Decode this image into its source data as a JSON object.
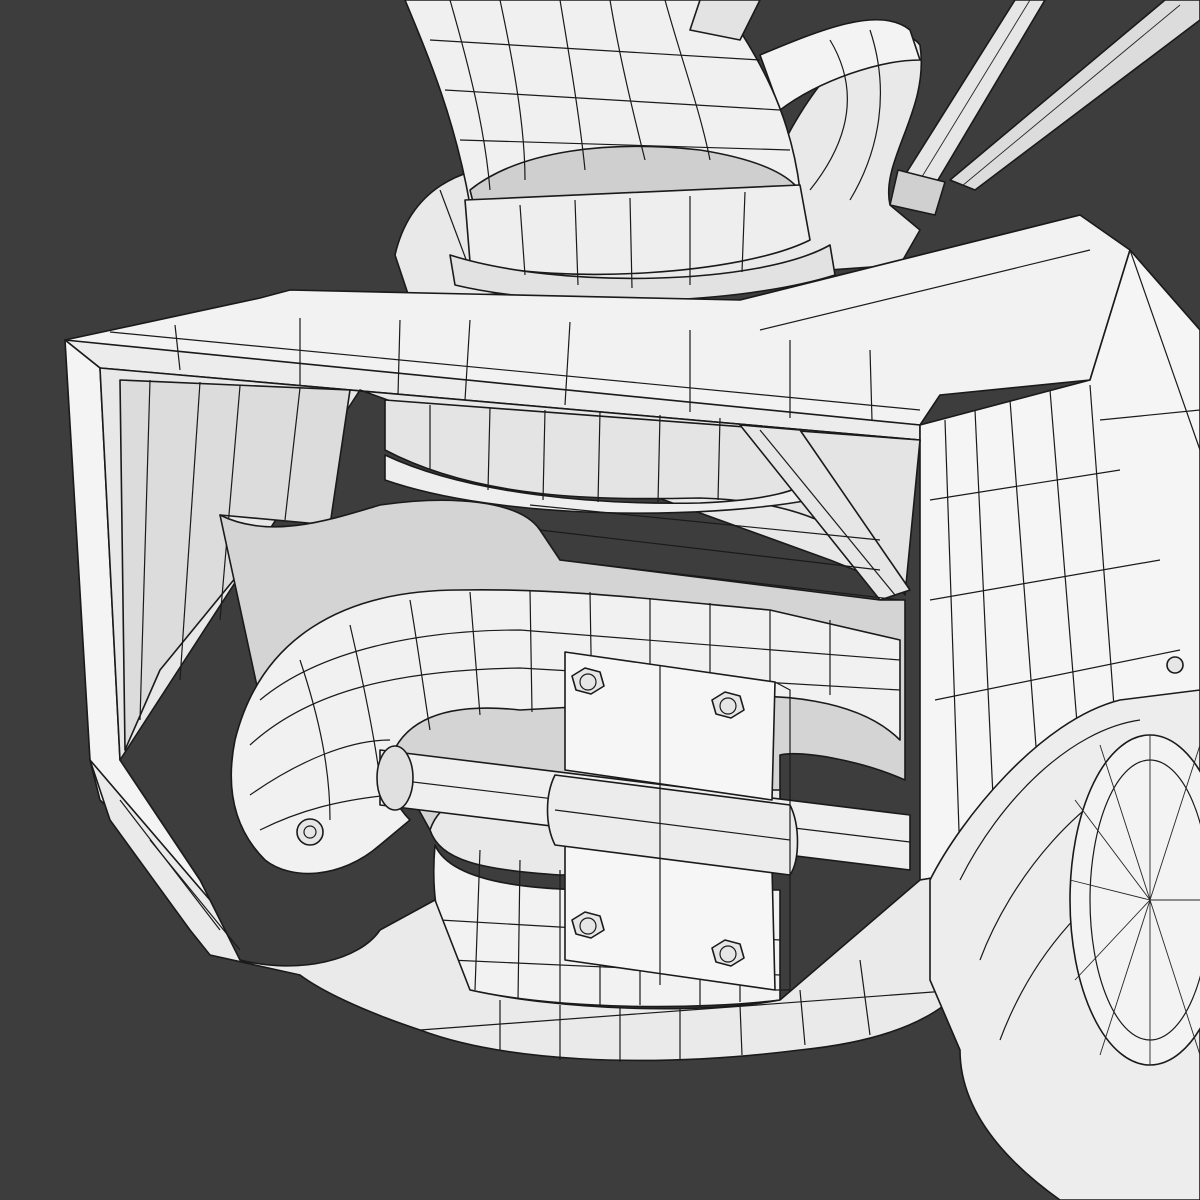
{
  "scene": {
    "subject": "snow-blower-wireframe-model",
    "background_color": "#3d3d3d",
    "surface_color": "#f2f2f2",
    "shade_color": "#d9d9d9",
    "deep_shade_color": "#bdbdbd",
    "wire_color": "#1a1a1a"
  },
  "parts": {
    "chute": "discharge-chute",
    "housing": "auger-housing",
    "auger": "spiral-auger",
    "plate": "center-mount-plate",
    "shaft": "auger-shaft",
    "wheel": "side-wheel",
    "handle": "handle-bars",
    "bolts": "hex-bolts"
  }
}
